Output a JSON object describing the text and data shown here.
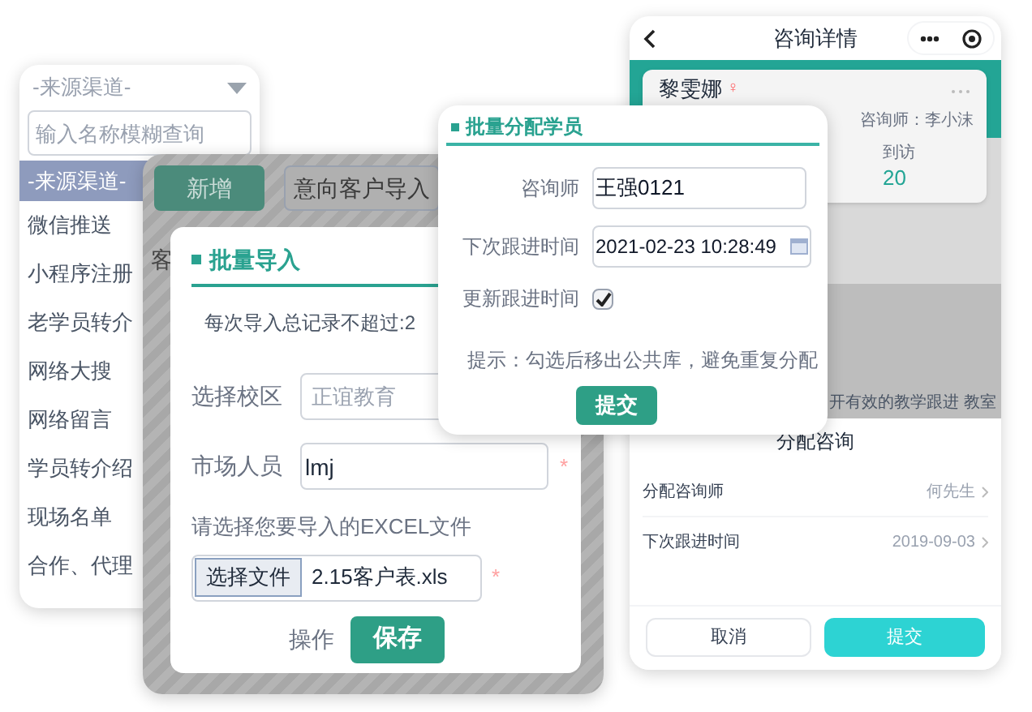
{
  "source_dropdown": {
    "title": "-来源渠道-",
    "search_placeholder": "输入名称模糊查询",
    "options": [
      {
        "label": "-来源渠道-",
        "selected": true
      },
      {
        "label": "微信推送",
        "selected": false
      },
      {
        "label": "小程序注册",
        "selected": false
      },
      {
        "label": "老学员转介",
        "selected": false
      },
      {
        "label": "网络大搜",
        "selected": false
      },
      {
        "label": "网络留言",
        "selected": false
      },
      {
        "label": "学员转介绍",
        "selected": false
      },
      {
        "label": "现场名单",
        "selected": false
      },
      {
        "label": "合作、代理",
        "selected": false
      }
    ]
  },
  "import_page": {
    "buttons": [
      "新增",
      "意向客户导入"
    ],
    "fragment": "客"
  },
  "import_dialog": {
    "title": "批量导入",
    "notice": "每次导入总记录不超过:2",
    "campus": {
      "label": "选择校区",
      "placeholder": "正谊教育"
    },
    "marketer": {
      "label": "市场人员",
      "value": "lmj",
      "required_mark": "*"
    },
    "file_prompt": "请选择您要导入的EXCEL文件",
    "file": {
      "button": "选择文件",
      "value": "2.15客户表.xls",
      "required_mark": "*"
    },
    "action_label": "操作",
    "save": "保存"
  },
  "assign_dialog": {
    "title": "批量分配学员",
    "consultant": {
      "label": "咨询师",
      "value": "王强0121"
    },
    "next_followup": {
      "label": "下次跟进时间",
      "value": "2021-02-23 10:28:49"
    },
    "update_followup": {
      "label": "更新跟进时间",
      "checked": true
    },
    "hint": "提示：勾选后移出公共库，避免重复分配",
    "submit": "提交"
  },
  "mobile": {
    "title": "咨询详情",
    "student": {
      "name": "黎雯娜",
      "gender": "♀",
      "consultant": "咨询师：李小沫",
      "visits_label": "到访",
      "visits": "20"
    },
    "background_text": "开有效的教学跟进 教室",
    "sheet": {
      "title": "分配咨询",
      "rows": [
        {
          "label": "分配咨询师",
          "value": "何先生"
        },
        {
          "label": "下次跟进时间",
          "value": "2019-09-03"
        }
      ],
      "cancel": "取消",
      "submit": "提交"
    }
  }
}
